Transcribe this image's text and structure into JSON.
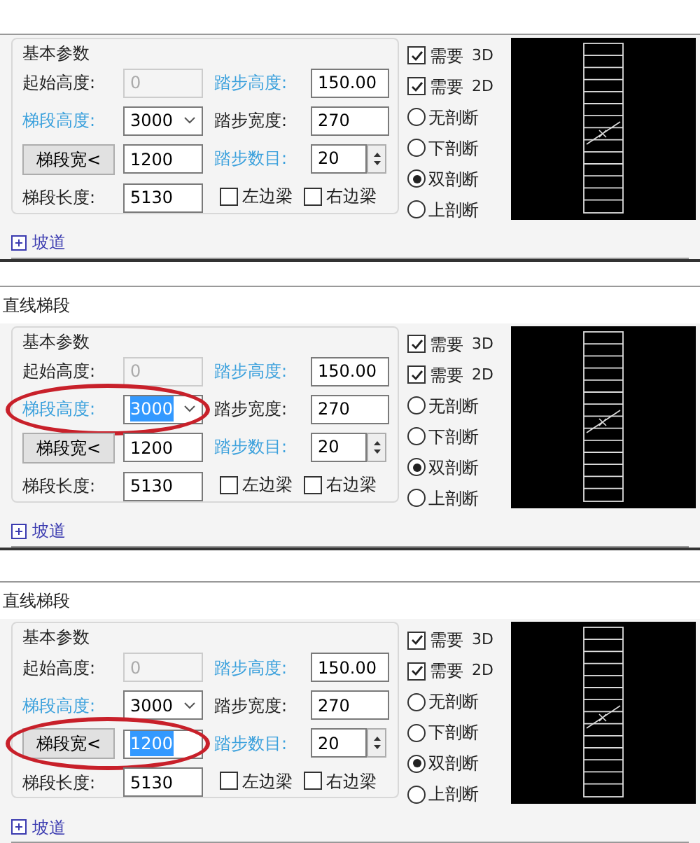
{
  "panels": [
    {
      "group_title": "基本参数",
      "left_params": [
        {
          "kind": "text",
          "label": "起始高度:",
          "highlighted": false,
          "value": "0",
          "disabled": true,
          "text_selected": false,
          "circled": false
        },
        {
          "kind": "dropdown",
          "label": "梯段高度:",
          "highlighted": true,
          "value": "3000",
          "disabled": false,
          "text_selected": false,
          "circled": false
        },
        {
          "kind": "button",
          "label": "梯段宽<",
          "highlighted": false,
          "value": "1200",
          "disabled": false,
          "text_selected": false,
          "circled": false
        },
        {
          "kind": "text",
          "label": "梯段长度:",
          "highlighted": false,
          "value": "5130",
          "disabled": false,
          "text_selected": false,
          "circled": false
        }
      ],
      "middle_params": [
        {
          "kind": "text",
          "label": "踏步高度:",
          "highlighted": true,
          "value": "150.00"
        },
        {
          "kind": "text",
          "label": "踏步宽度:",
          "highlighted": false,
          "value": "270"
        },
        {
          "kind": "spin",
          "label": "踏步数目:",
          "highlighted": true,
          "value": "20"
        }
      ],
      "beam_checkboxes": [
        {
          "label": "左边梁",
          "checked": false
        },
        {
          "label": "右边梁",
          "checked": false
        }
      ],
      "view_options": [
        {
          "label": "需要",
          "tag": "3D",
          "checked": true
        },
        {
          "label": "需要",
          "tag": "2D",
          "checked": true
        }
      ],
      "section_options": [
        {
          "label": "无剖断",
          "selected": false
        },
        {
          "label": "下剖断",
          "selected": false
        },
        {
          "label": "双剖断",
          "selected": true
        },
        {
          "label": "上剖断",
          "selected": false
        }
      ],
      "ramp": {
        "label": "坡道",
        "expanded": false
      }
    },
    {
      "title": "直线梯段",
      "group_title": "基本参数",
      "left_params": [
        {
          "kind": "text",
          "label": "起始高度:",
          "highlighted": false,
          "value": "0",
          "disabled": true,
          "text_selected": false,
          "circled": false
        },
        {
          "kind": "dropdown",
          "label": "梯段高度:",
          "highlighted": true,
          "value": "3000",
          "disabled": false,
          "text_selected": true,
          "circled": true
        },
        {
          "kind": "button",
          "label": "梯段宽<",
          "highlighted": false,
          "value": "1200",
          "disabled": false,
          "text_selected": false,
          "circled": false
        },
        {
          "kind": "text",
          "label": "梯段长度:",
          "highlighted": false,
          "value": "5130",
          "disabled": false,
          "text_selected": false,
          "circled": false
        }
      ],
      "middle_params": [
        {
          "kind": "text",
          "label": "踏步高度:",
          "highlighted": true,
          "value": "150.00"
        },
        {
          "kind": "text",
          "label": "踏步宽度:",
          "highlighted": false,
          "value": "270"
        },
        {
          "kind": "spin",
          "label": "踏步数目:",
          "highlighted": true,
          "value": "20"
        }
      ],
      "beam_checkboxes": [
        {
          "label": "左边梁",
          "checked": false
        },
        {
          "label": "右边梁",
          "checked": false
        }
      ],
      "view_options": [
        {
          "label": "需要",
          "tag": "3D",
          "checked": true
        },
        {
          "label": "需要",
          "tag": "2D",
          "checked": true
        }
      ],
      "section_options": [
        {
          "label": "无剖断",
          "selected": false
        },
        {
          "label": "下剖断",
          "selected": false
        },
        {
          "label": "双剖断",
          "selected": true
        },
        {
          "label": "上剖断",
          "selected": false
        }
      ],
      "ramp": {
        "label": "坡道",
        "expanded": false
      }
    },
    {
      "title": "直线梯段",
      "group_title": "基本参数",
      "left_params": [
        {
          "kind": "text",
          "label": "起始高度:",
          "highlighted": false,
          "value": "0",
          "disabled": true,
          "text_selected": false,
          "circled": false
        },
        {
          "kind": "dropdown",
          "label": "梯段高度:",
          "highlighted": true,
          "value": "3000",
          "disabled": false,
          "text_selected": false,
          "circled": false
        },
        {
          "kind": "button",
          "label": "梯段宽<",
          "highlighted": false,
          "value": "1200",
          "disabled": false,
          "text_selected": true,
          "circled": true
        },
        {
          "kind": "text",
          "label": "梯段长度:",
          "highlighted": false,
          "value": "5130",
          "disabled": false,
          "text_selected": false,
          "circled": false
        }
      ],
      "middle_params": [
        {
          "kind": "text",
          "label": "踏步高度:",
          "highlighted": true,
          "value": "150.00"
        },
        {
          "kind": "text",
          "label": "踏步宽度:",
          "highlighted": false,
          "value": "270"
        },
        {
          "kind": "spin",
          "label": "踏步数目:",
          "highlighted": true,
          "value": "20"
        }
      ],
      "beam_checkboxes": [
        {
          "label": "左边梁",
          "checked": false
        },
        {
          "label": "右边梁",
          "checked": false
        }
      ],
      "view_options": [
        {
          "label": "需要",
          "tag": "3D",
          "checked": true
        },
        {
          "label": "需要",
          "tag": "2D",
          "checked": true
        }
      ],
      "section_options": [
        {
          "label": "无剖断",
          "selected": false
        },
        {
          "label": "下剖断",
          "selected": false
        },
        {
          "label": "双剖断",
          "selected": true
        },
        {
          "label": "上剖断",
          "selected": false
        }
      ],
      "ramp": {
        "label": "坡道",
        "expanded": false
      }
    }
  ]
}
